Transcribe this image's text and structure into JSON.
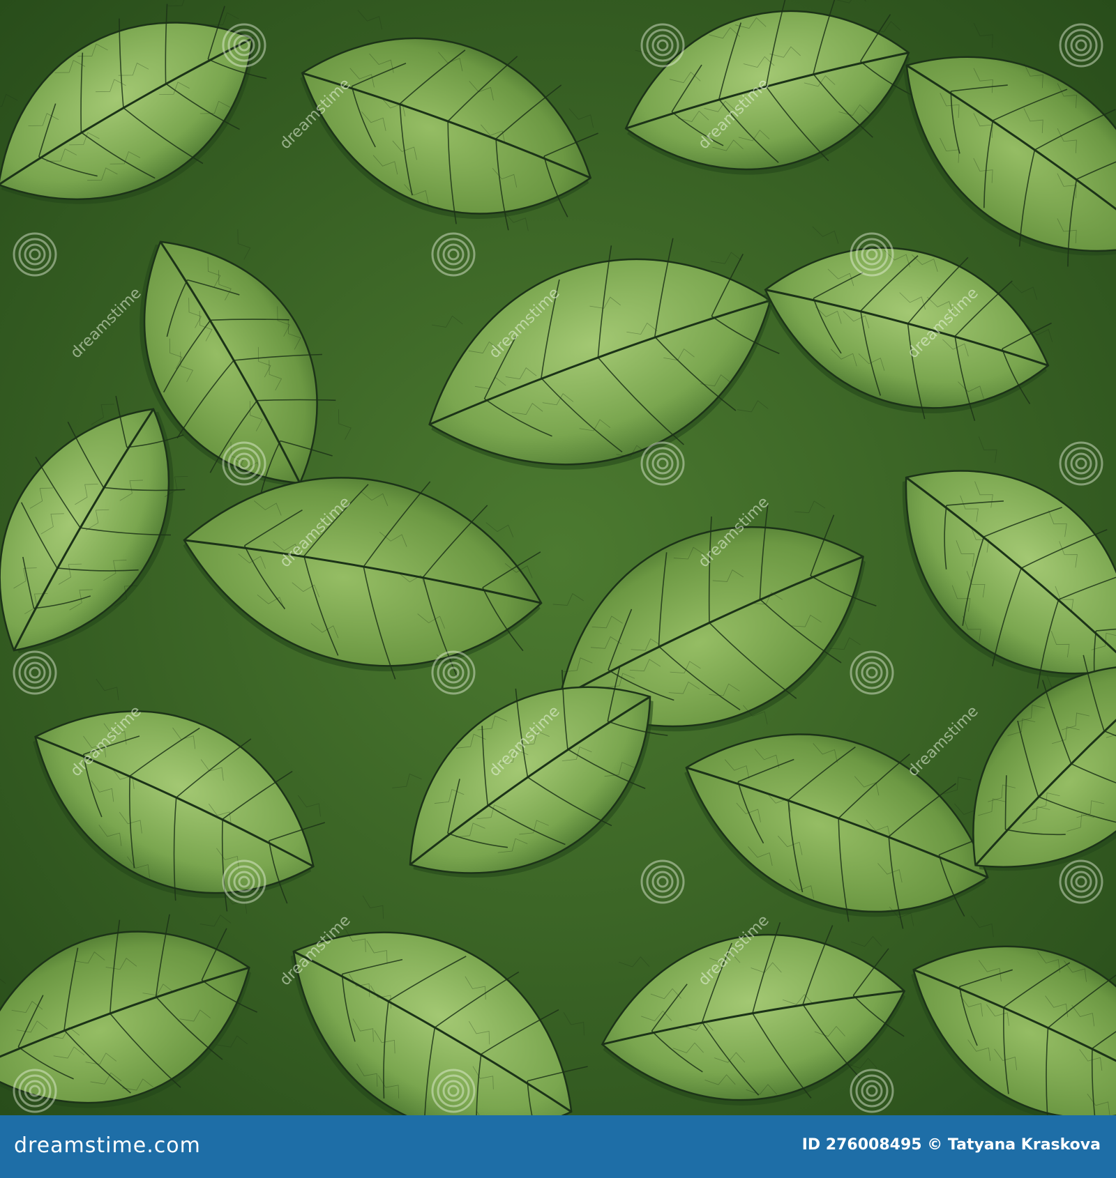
{
  "image": {
    "subject": "green-leaf-texture",
    "palette": {
      "light_leaf": "#9dc46a",
      "mid_leaf": "#73a04a",
      "dark_leaf": "#3e6a27",
      "vein": "#1c3318",
      "shadow": "#22461a"
    }
  },
  "watermark": {
    "brand_text": "dreamstime",
    "icon": "spiral-icon"
  },
  "footer": {
    "brand": "dreamstime.com",
    "id_label": "ID 276008495",
    "copyright_symbol": "©",
    "author": "Tatyana Kraskova",
    "background": "#1e6ea7"
  }
}
